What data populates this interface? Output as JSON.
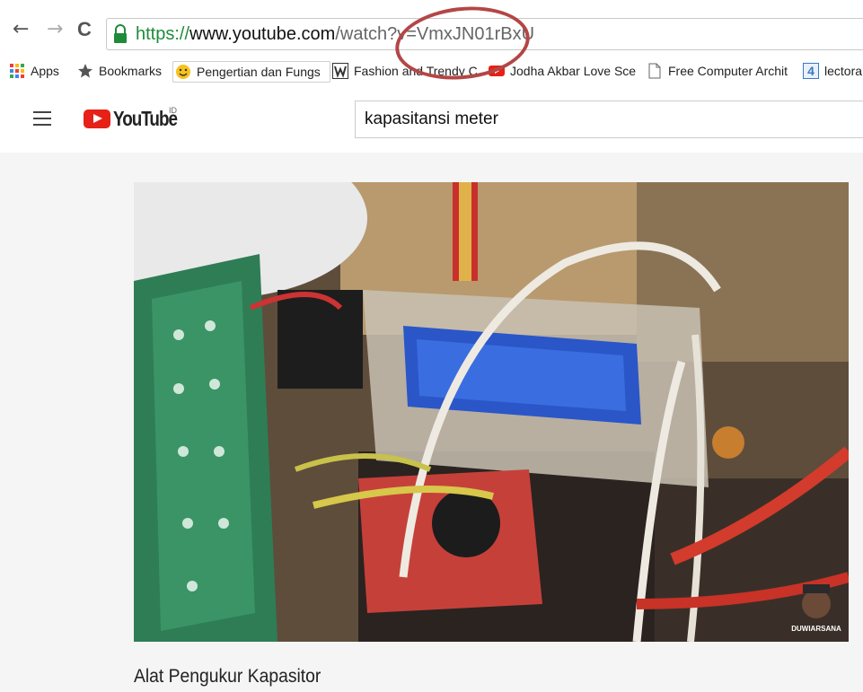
{
  "browser": {
    "nav": {
      "back": "←",
      "forward": "→",
      "reload": "C"
    },
    "url": {
      "scheme": "https://",
      "host": "www.youtube.com",
      "path": "/watch?v=VmxJN01rBxU"
    },
    "bookmarks": [
      {
        "label": "Apps",
        "icon": "apps-grid-icon"
      },
      {
        "label": "Bookmarks",
        "icon": "star-icon"
      },
      {
        "label": "Pengertian dan Fungs",
        "icon": "smiley-icon"
      },
      {
        "label": "Fashion and Trendy C",
        "icon": "w-logo-icon"
      },
      {
        "label": "Jodha Akbar Love Sce",
        "icon": "youtube-icon"
      },
      {
        "label": "Free Computer Archit",
        "icon": "page-icon"
      },
      {
        "label": "lectora",
        "icon": "four-logo-icon"
      }
    ]
  },
  "youtube": {
    "logo_text": "YouTube",
    "country": "ID",
    "search_query": "kapasitansi meter"
  },
  "video": {
    "title": "Alat Pengukur Kapasitor",
    "watermark": "DUWIARSANA"
  },
  "colors": {
    "url_circle": "#b44646",
    "youtube_red": "#e62117",
    "secure_green": "#1f8b3a"
  }
}
